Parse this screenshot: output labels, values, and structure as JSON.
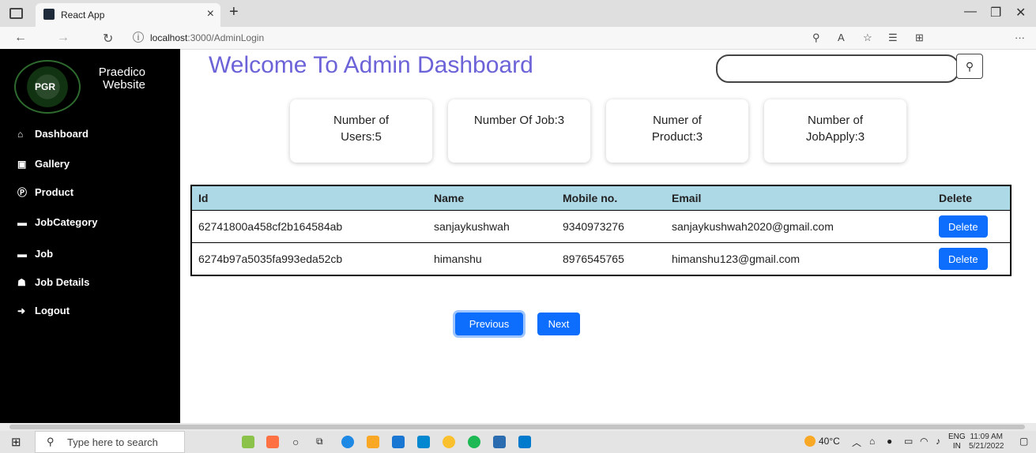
{
  "browser": {
    "tab_title": "React App",
    "tab_close": "×",
    "new_tab": "+",
    "url_host": "localhost",
    "url_path": ":3000/AdminLogin"
  },
  "sidebar": {
    "brand_line1": "Praedico",
    "brand_line2": "Website",
    "logo_mark": "PGR",
    "items": [
      {
        "label": "Dashboard",
        "icon": "home-icon"
      },
      {
        "label": "Gallery",
        "icon": "image-icon"
      },
      {
        "label": "Product",
        "icon": "product-p-icon"
      },
      {
        "label": "JobCategory",
        "icon": "briefcase-icon"
      },
      {
        "label": "Job",
        "icon": "briefcase-icon"
      },
      {
        "label": "Job Details",
        "icon": "user-secret-icon"
      },
      {
        "label": "Logout",
        "icon": "logout-icon"
      }
    ]
  },
  "main": {
    "title": "Welcome To Admin Dashboard",
    "search_placeholder": "",
    "cards": [
      {
        "line1": "Number of",
        "line2": "Users:5"
      },
      {
        "line1": "Number Of Job:3",
        "line2": ""
      },
      {
        "line1": "Numer of",
        "line2": "Product:3"
      },
      {
        "line1": "Number of",
        "line2": "JobApply:3"
      }
    ],
    "table": {
      "headers": [
        "Id",
        "Name",
        "Mobile no.",
        "Email",
        "Delete"
      ],
      "rows": [
        {
          "id": "62741800a458cf2b164584ab",
          "name": "sanjaykushwah",
          "mobile": "9340973276",
          "email": "sanjaykushwah2020@gmail.com",
          "action": "Delete"
        },
        {
          "id": "6274b97a5035fa993eda52cb",
          "name": "himanshu",
          "mobile": "8976545765",
          "email": "himanshu123@gmail.com",
          "action": "Delete"
        }
      ]
    },
    "pagination": {
      "previous": "Previous",
      "next": "Next"
    }
  },
  "taskbar": {
    "search_placeholder": "Type here to search",
    "weather": "40°C",
    "lang_line1": "ENG",
    "lang_line2": "IN",
    "time": "11:09 AM",
    "date": "5/21/2022"
  },
  "colors": {
    "title": "#6c63d8",
    "accent": "#0d6efd",
    "table_header": "#add8e6",
    "sidebar": "#000000"
  }
}
